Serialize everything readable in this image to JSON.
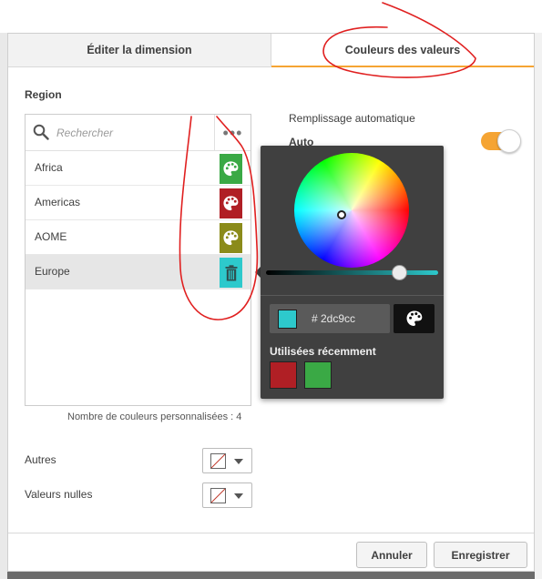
{
  "tabs": [
    {
      "label": "Éditer la dimension"
    },
    {
      "label": "Couleurs des valeurs"
    }
  ],
  "section_title": "Region",
  "search": {
    "placeholder": "Rechercher"
  },
  "more_glyph": "•••",
  "values": [
    {
      "label": "Africa",
      "color": "#3aa945",
      "icon": "palette-icon"
    },
    {
      "label": "Americas",
      "color": "#b01f25",
      "icon": "palette-icon"
    },
    {
      "label": "AOME",
      "color": "#8b8b1a",
      "icon": "palette-icon"
    },
    {
      "label": "Europe",
      "color": "#2dc9cc",
      "icon": "trash-icon"
    }
  ],
  "custom_count_text": "Nombre de couleurs personnalisées : 4",
  "others_label": "Autres",
  "nulls_label": "Valeurs nulles",
  "auto_fill": {
    "label": "Remplissage automatique",
    "value": "Auto",
    "enabled": true
  },
  "picker": {
    "hex_value": "# 2dc9cc",
    "selected_color": "#2dc9cc",
    "recent_label": "Utilisées récemment",
    "recent_colors": [
      "#b01f25",
      "#3aa945"
    ]
  },
  "footer": {
    "cancel_label": "Annuler",
    "save_label": "Enregistrer"
  },
  "accent_color": "#f5a433"
}
